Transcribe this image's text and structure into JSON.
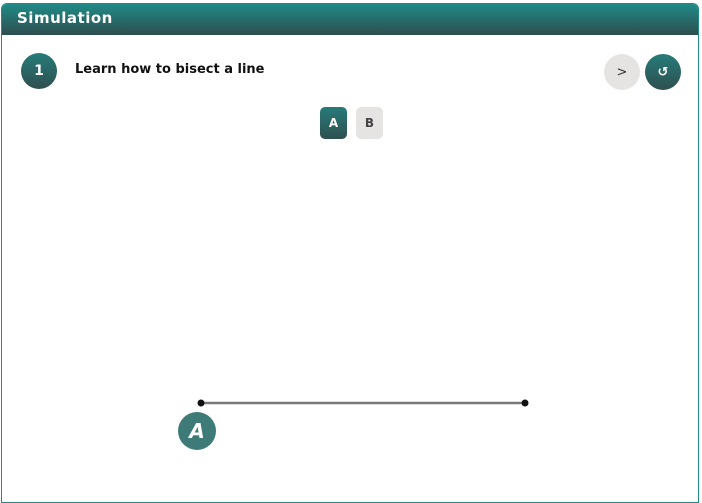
{
  "header": {
    "title": "Simulation"
  },
  "step": {
    "number": "1",
    "instruction": "Learn how to bisect a line"
  },
  "controls": {
    "next_label": ">",
    "reset_label": "↺"
  },
  "tabs": [
    {
      "label": "A",
      "active": true
    },
    {
      "label": "B",
      "active": false
    }
  ],
  "canvas": {
    "point_label": "A"
  },
  "colors": {
    "accent": "#267c7a",
    "inactive": "#e6e3e3",
    "line": "#7a7a7a"
  }
}
